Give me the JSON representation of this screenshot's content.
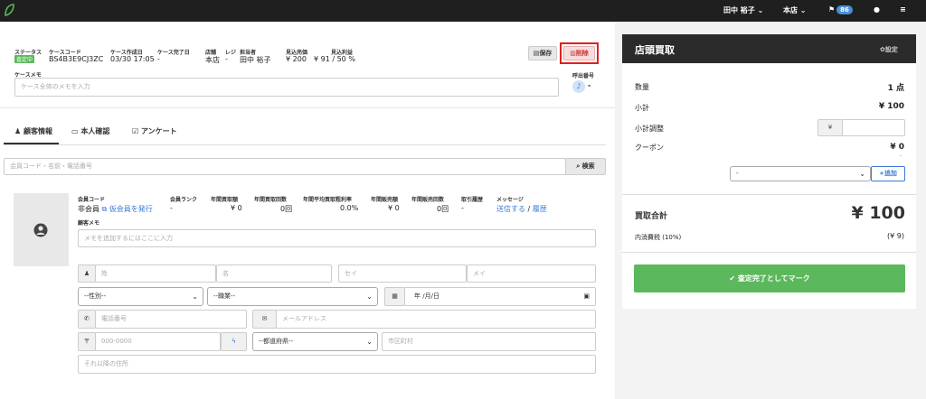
{
  "topbar": {
    "user": "田中 裕子",
    "store": "本店",
    "notif_count": "86"
  },
  "case": {
    "status_label": "ステータス",
    "status_badge": "査定中",
    "code_label": "ケースコード",
    "code": "BS4B3E9CJ3ZC",
    "created_label": "ケース作成日",
    "created": "03/30 17:05",
    "completed_label": "ケース完了日",
    "completed": "-",
    "shop_label": "店舗",
    "shop": "本店",
    "register_label": "レジ",
    "register": "-",
    "staff_label": "担当者",
    "staff": "田中 裕子",
    "est_sales_label": "見込売価",
    "est_sales": "¥ 200",
    "est_profit_label": "見込利益",
    "est_profit": "¥ 91 / 50 %",
    "save": "保存",
    "delete": "削除",
    "memo_label": "ケースメモ",
    "memo_placeholder": "ケース全体のメモを入力",
    "call_label": "呼出番号",
    "call_value": "-"
  },
  "tabs": [
    "顧客情報",
    "本人確認",
    "アンケート"
  ],
  "search": {
    "placeholder": "会員コード・名前・電話番号",
    "button": "検索"
  },
  "member": {
    "code_label": "会員コード",
    "code_value": "非会員",
    "issue_link": "仮会員を発行",
    "rank_label": "会員ランク",
    "rank": "-",
    "annual_buy_label": "年間買取額",
    "annual_buy": "¥ 0",
    "annual_buy_count_label": "年間買取回数",
    "annual_buy_count": "0回",
    "annual_profit_label": "年間平均買取粗利率",
    "annual_profit": "0.0%",
    "annual_sales_label": "年間販売額",
    "annual_sales": "¥ 0",
    "annual_sales_count_label": "年間販売回数",
    "annual_sales_count": "0回",
    "history_label": "取引履歴",
    "history": "-",
    "message_label": "メッセージ",
    "send": "送信する",
    "sep": "/",
    "history_link": "履歴",
    "memo_label": "顧客メモ",
    "memo_placeholder": "メモを追加するにはここに入力"
  },
  "form": {
    "last": "姓",
    "first": "名",
    "last_kana": "セイ",
    "first_kana": "メイ",
    "gender": "--性別--",
    "job": "--職業--",
    "date": "年 /月/日",
    "phone": "電話番号",
    "email": "メールアドレス",
    "postal_icon": "〒",
    "postal": "000-0000",
    "pref": "--都道府県--",
    "city": "市区町村",
    "address": "それ以降の住所"
  },
  "right": {
    "title": "店頭買取",
    "settings": "設定",
    "qty_label": "数量",
    "qty": "1 点",
    "subtotal_label": "小計",
    "subtotal": "¥ 100",
    "adjust_label": "小計調整",
    "yen": "¥",
    "coupon_label": "クーポン",
    "coupon": "¥ 0",
    "coupon_dash": "-",
    "coupon_select": "-",
    "add": "追加",
    "total_label": "買取合計",
    "total": "¥ 100",
    "tax_label": "内消費税 (10%)",
    "tax": "(¥ 9)",
    "complete": "査定完了としてマーク"
  },
  "colors": {
    "accent": "#5cb85c",
    "delete_border": "#e02020",
    "link": "#3a7bd5",
    "dark": "#1f1f1f"
  }
}
